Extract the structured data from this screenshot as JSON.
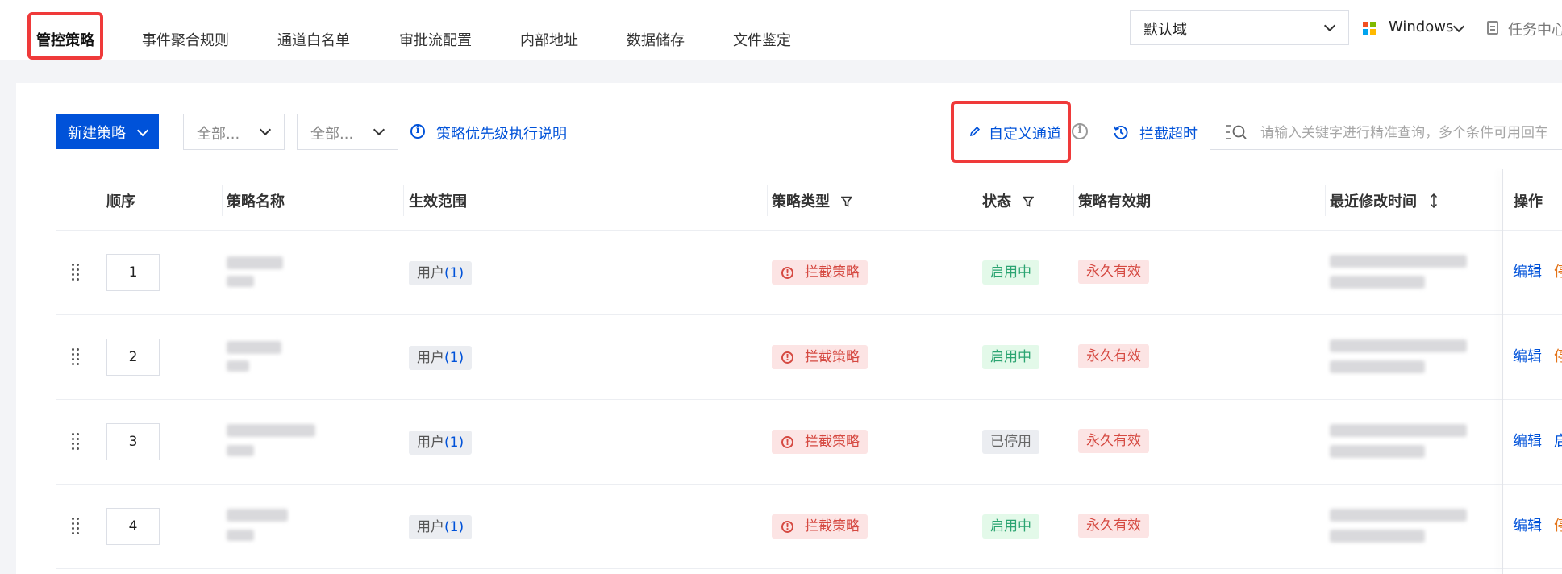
{
  "tabs": [
    "管控策略",
    "事件聚合规则",
    "通道白名单",
    "审批流配置",
    "内部地址",
    "数据储存",
    "文件鉴定"
  ],
  "header": {
    "domain_select": "默认域",
    "os": "Windows",
    "task_center": "任务中心"
  },
  "toolbar": {
    "new_policy": "新建策略",
    "filter1": "全部...",
    "filter2": "全部...",
    "priority_link": "策略优先级执行说明",
    "custom_channel": "自定义通道",
    "intercept_timeout": "拦截超时",
    "search_placeholder": "请输入关键字进行精准查询，多个条件可用回车"
  },
  "table": {
    "headers": {
      "order": "顺序",
      "name": "策略名称",
      "scope": "生效范围",
      "type": "策略类型",
      "status": "状态",
      "validity": "策略有效期",
      "modified": "最近修改时间",
      "actions": "操作"
    },
    "rows": [
      {
        "order": "1",
        "scope_label": "用户",
        "scope_count": "(1)",
        "type": "拦截策略",
        "status": "启用中",
        "status_on": true,
        "validity": "永久有效",
        "edit": "编辑",
        "toggle": "停"
      },
      {
        "order": "2",
        "scope_label": "用户",
        "scope_count": "(1)",
        "type": "拦截策略",
        "status": "启用中",
        "status_on": true,
        "validity": "永久有效",
        "edit": "编辑",
        "toggle": "停"
      },
      {
        "order": "3",
        "scope_label": "用户",
        "scope_count": "(1)",
        "type": "拦截策略",
        "status": "已停用",
        "status_on": false,
        "validity": "永久有效",
        "edit": "编辑",
        "toggle": "启"
      },
      {
        "order": "4",
        "scope_label": "用户",
        "scope_count": "(1)",
        "type": "拦截策略",
        "status": "启用中",
        "status_on": true,
        "validity": "永久有效",
        "edit": "编辑",
        "toggle": "停"
      }
    ]
  },
  "colors": {
    "primary": "#0052d9",
    "highlight": "#ef3a3a",
    "danger": "#d54941",
    "success": "#2ba471",
    "warning": "#e37318"
  },
  "icons": [
    "windows-icon",
    "document-icon",
    "chevron-down-icon",
    "info-icon",
    "pencil-icon",
    "history-icon",
    "search-icon",
    "filter-icon",
    "sort-icon",
    "drag-handle-icon",
    "warning-icon"
  ]
}
